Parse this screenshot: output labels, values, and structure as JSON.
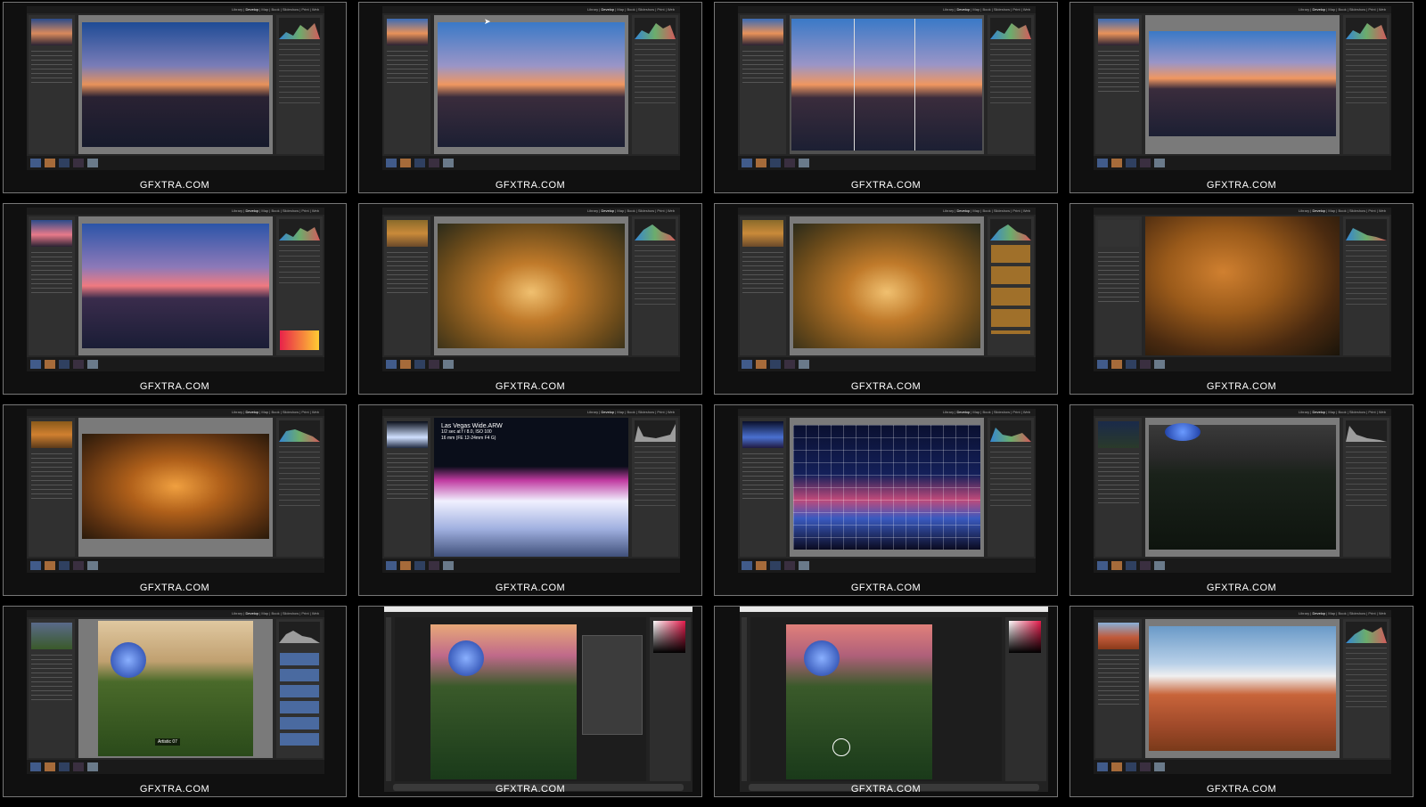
{
  "watermark": "GFXTRA.COM",
  "lr_modules": {
    "library": "Library",
    "develop": "Develop",
    "map": "Map",
    "book": "Book",
    "slideshow": "Slideshow",
    "print": "Print",
    "web": "Web"
  },
  "overlay": {
    "filename": "Las Vegas Wide.ARW",
    "line2": "1/2 sec at f / 8.0, ISO 100",
    "line3": "16 mm (FE 12-24mm F4 G)"
  },
  "badge_text": "Artistic 07",
  "colors": {
    "background": "#000000",
    "panel": "#303030",
    "canvas": "#7a7a7a",
    "watermark": "#ffffff"
  },
  "thumbnails": [
    {
      "id": 1,
      "scene": "las-vegas-dusk",
      "app": "lightroom"
    },
    {
      "id": 2,
      "scene": "las-vegas-dusk",
      "app": "lightroom"
    },
    {
      "id": 3,
      "scene": "las-vegas-dusk-split",
      "app": "lightroom"
    },
    {
      "id": 4,
      "scene": "las-vegas-dusk-crop",
      "app": "lightroom"
    },
    {
      "id": 5,
      "scene": "las-vegas-dusk-gradient",
      "app": "lightroom"
    },
    {
      "id": 6,
      "scene": "autumn-park",
      "app": "lightroom"
    },
    {
      "id": 7,
      "scene": "autumn-park-presets",
      "app": "lightroom"
    },
    {
      "id": 8,
      "scene": "autumn-park-dark",
      "app": "lightroom"
    },
    {
      "id": 9,
      "scene": "autumn-park-wide",
      "app": "lightroom"
    },
    {
      "id": 10,
      "scene": "fountain-night-overlay",
      "app": "lightroom"
    },
    {
      "id": 11,
      "scene": "fountain-night-grid",
      "app": "lightroom"
    },
    {
      "id": 12,
      "scene": "sphere-golf-dark",
      "app": "lightroom"
    },
    {
      "id": 13,
      "scene": "sphere-golf-profile",
      "app": "lightroom"
    },
    {
      "id": 14,
      "scene": "sphere-golf-photoshop",
      "app": "photoshop"
    },
    {
      "id": 15,
      "scene": "sphere-golf-photoshop-brush",
      "app": "photoshop"
    },
    {
      "id": 16,
      "scene": "red-rock-desert",
      "app": "lightroom"
    }
  ]
}
